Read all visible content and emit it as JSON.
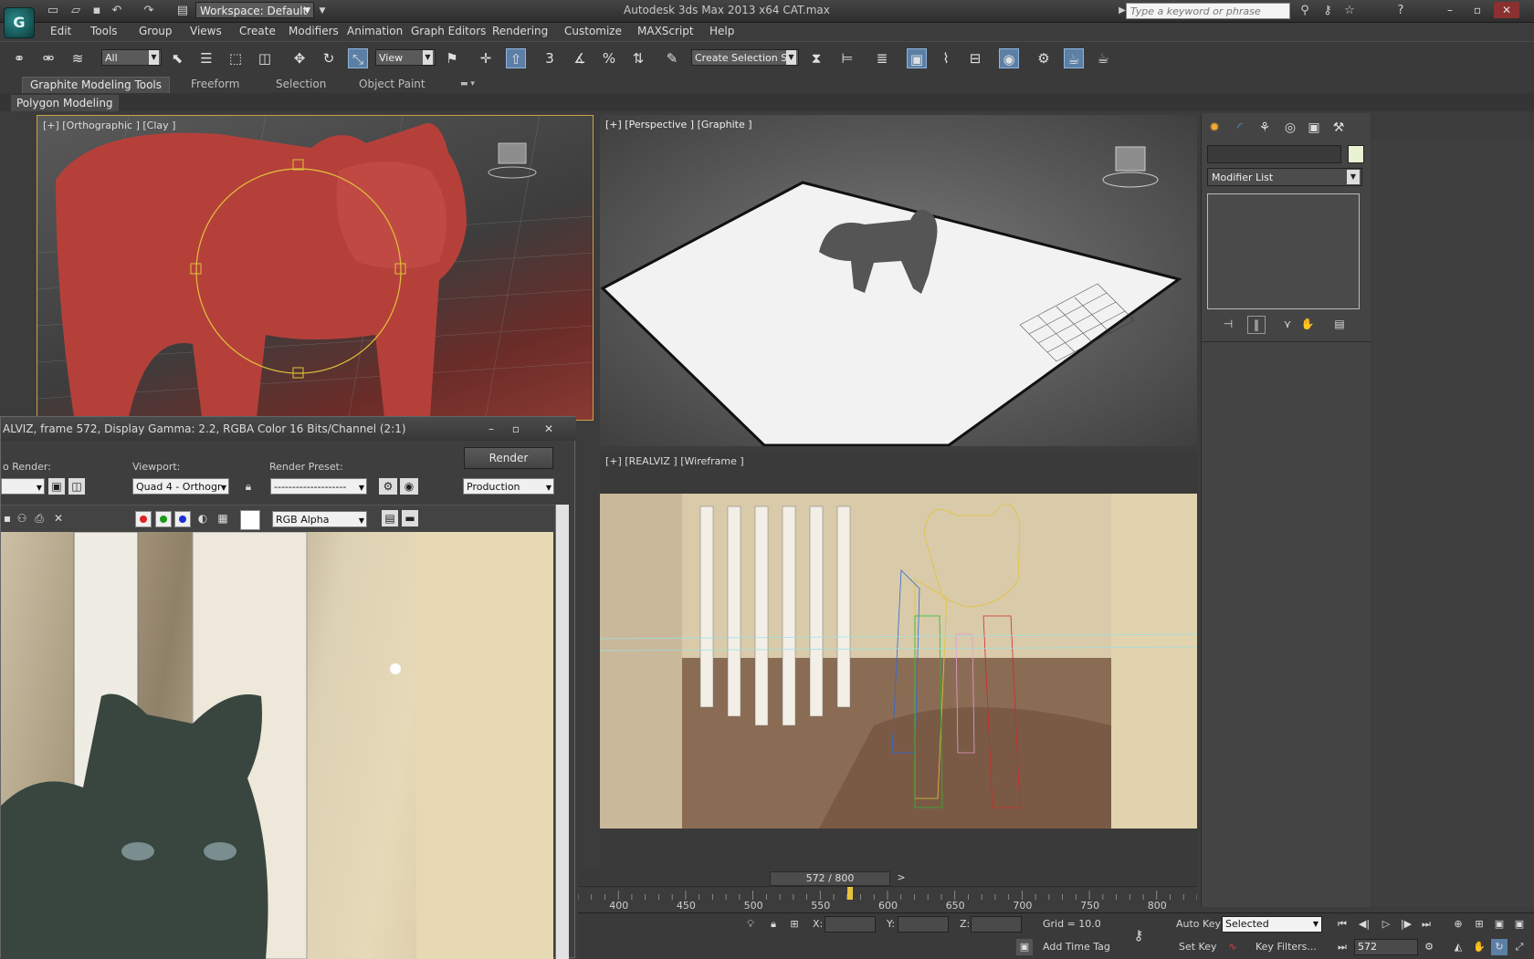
{
  "window": {
    "title": "Autodesk 3ds Max  2013 x64     CAT.max",
    "workspace": "Workspace: Default",
    "search_placeholder": "Type a keyword or phrase"
  },
  "menu": [
    "Edit",
    "Tools",
    "Group",
    "Views",
    "Create",
    "Modifiers",
    "Animation",
    "Graph Editors",
    "Rendering",
    "Customize",
    "MAXScript",
    "Help"
  ],
  "toolbar": {
    "selection_filter": "All",
    "ref_coord": "View",
    "named_selection": "Create Selection Se"
  },
  "ribbon": {
    "tabs": [
      "Graphite Modeling Tools",
      "Freeform",
      "Selection",
      "Object Paint"
    ],
    "panel_label": "Polygon Modeling"
  },
  "viewports": {
    "top_left": "[+] [Orthographic ] [Clay ]",
    "top_right": "[+] [Perspective ] [Graphite ]",
    "bottom_right": "[+] [REALVIZ ] [Wireframe ]"
  },
  "command_panel": {
    "modifier_list": "Modifier List"
  },
  "render_window": {
    "title": "ALVIZ, frame 572, Display Gamma: 2.2, RGBA Color 16 Bits/Channel (2:1)",
    "area_label": "o Render:",
    "viewport_label": "Viewport:",
    "viewport_value": "Quad 4 - Orthogr",
    "preset_label": "Render Preset:",
    "preset_value": "--------------------",
    "render_button": "Render",
    "mode_value": "Production",
    "channel_value": "RGB Alpha"
  },
  "timeline": {
    "frame_display": "572 / 800",
    "ticks": [
      "400",
      "450",
      "500",
      "550",
      "600",
      "650",
      "700",
      "750",
      "800"
    ],
    "current_frame": 572,
    "total_frames": 800
  },
  "status": {
    "x_label": "X:",
    "y_label": "Y:",
    "z_label": "Z:",
    "grid": "Grid = 10.0",
    "add_time_tag": "Add Time Tag",
    "auto_key": "Auto Key",
    "set_key": "Set Key",
    "key_mode": "Selected",
    "key_filters": "Key Filters...",
    "frame_field": "572"
  },
  "colors": {
    "accent": "#5c7fa6",
    "clay": "#b5403a",
    "wire_yellow": "#e0c23a"
  }
}
